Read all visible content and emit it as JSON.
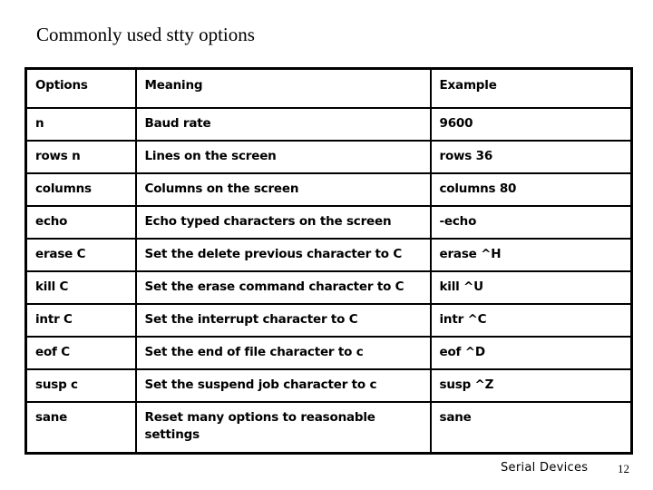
{
  "slide": {
    "title": "Commonly used stty options"
  },
  "table": {
    "columns": [
      "Options",
      "Meaning",
      "Example"
    ],
    "rows": [
      {
        "option": "n",
        "meaning": "Baud rate",
        "example": "9600"
      },
      {
        "option": "rows n",
        "meaning": "Lines on the screen",
        "example": "rows 36"
      },
      {
        "option": "columns",
        "meaning": "Columns on the screen",
        "example": "columns 80"
      },
      {
        "option": "echo",
        "meaning": "Echo typed characters on the screen",
        "example": "-echo"
      },
      {
        "option": "erase C",
        "meaning": "Set the delete previous character to C",
        "example": "erase ^H"
      },
      {
        "option": "kill C",
        "meaning": "Set the erase command character to C",
        "example": "kill ^U"
      },
      {
        "option": "intr C",
        "meaning": "Set the interrupt character to C",
        "example": "intr ^C"
      },
      {
        "option": "eof C",
        "meaning": "Set the end of file character to c",
        "example": "eof ^D"
      },
      {
        "option": "susp c",
        "meaning": "Set the suspend job character to c",
        "example": "susp ^Z"
      },
      {
        "option": "sane",
        "meaning": "Reset many options to reasonable settings",
        "example": "sane"
      }
    ]
  },
  "footer": {
    "label": "Serial Devices",
    "page_number": "12"
  },
  "colors": {
    "background": "#ffffff",
    "text": "#000000",
    "border": "#000000"
  }
}
